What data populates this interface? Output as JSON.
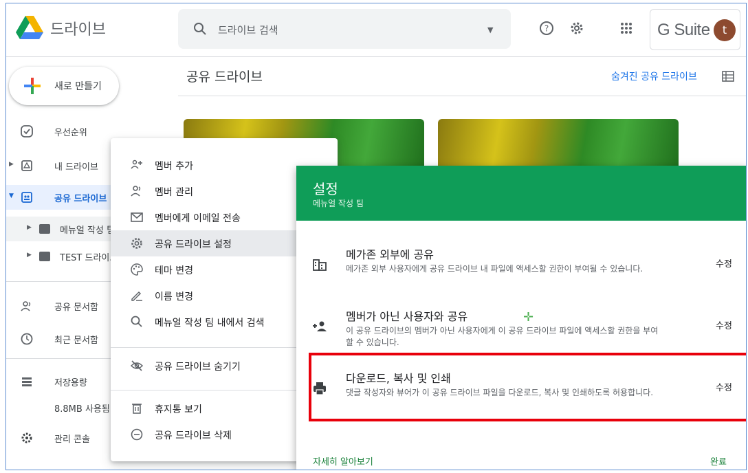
{
  "header": {
    "app_title": "드라이브",
    "search_placeholder": "드라이브 검색",
    "brand": "G Suite",
    "avatar_initial": "t"
  },
  "sidebar": {
    "new_button": "새로 만들기",
    "items": [
      {
        "label": "우선순위",
        "icon": "check-circle-icon"
      },
      {
        "label": "내 드라이브",
        "icon": "my-drive-icon"
      },
      {
        "label": "공유 드라이브",
        "icon": "shared-drive-icon"
      },
      {
        "label": "메뉴얼 작성 팀",
        "icon": "folder-icon"
      },
      {
        "label": "TEST 드라이브",
        "icon": "folder-icon"
      },
      {
        "label": "공유 문서함",
        "icon": "people-icon"
      },
      {
        "label": "최근 문서함",
        "icon": "clock-icon"
      },
      {
        "label": "저장용량",
        "icon": "storage-icon"
      },
      {
        "label": "8.8MB 사용됨",
        "icon": ""
      },
      {
        "label": "관리 콘솔",
        "icon": "admin-icon"
      }
    ]
  },
  "main": {
    "title": "공유 드라이브",
    "hidden_link": "숨겨진 공유 드라이브"
  },
  "context_menu": {
    "items": [
      {
        "label": "멤버 추가",
        "icon": "add-member-icon"
      },
      {
        "label": "멤버 관리",
        "icon": "manage-members-icon"
      },
      {
        "label": "멤버에게 이메일 전송",
        "icon": "email-icon"
      },
      {
        "label": "공유 드라이브 설정",
        "icon": "settings-icon"
      },
      {
        "label": "테마 변경",
        "icon": "palette-icon"
      },
      {
        "label": "이름 변경",
        "icon": "rename-icon"
      },
      {
        "label": "메뉴얼 작성 팀 내에서 검색",
        "icon": "search-icon"
      },
      {
        "label": "공유 드라이브 숨기기",
        "icon": "hide-icon"
      },
      {
        "label": "휴지통 보기",
        "icon": "trash-icon"
      },
      {
        "label": "공유 드라이브 삭제",
        "icon": "remove-icon"
      }
    ]
  },
  "settings_dialog": {
    "title": "설정",
    "subtitle": "메뉴얼 작성 팀",
    "options": [
      {
        "title": "메가존 외부에 공유",
        "description": "메가존 외부 사용자에게 공유 드라이브 내 파일에 액세스할 권한이 부여될 수 있습니다.",
        "action": "수정"
      },
      {
        "title": "멤버가 아닌 사용자와 공유",
        "description": "이 공유 드라이브의 멤버가 아닌 사용자에게 이 공유 드라이브 파일에 액세스할 권한을 부여할 수 있습니다.",
        "action": "수정"
      },
      {
        "title": "다운로드, 복사 및 인쇄",
        "description": "댓글 작성자와 뷰어가 이 공유 드라이브 파일을 다운로드, 복사 및 인쇄하도록 허용합니다.",
        "action": "수정"
      }
    ],
    "learn_more": "자세히 알아보기",
    "done": "완료"
  },
  "colors": {
    "accent_blue": "#1a73e8",
    "dialog_green": "#0f9d58",
    "highlight_red": "#e8000b"
  }
}
